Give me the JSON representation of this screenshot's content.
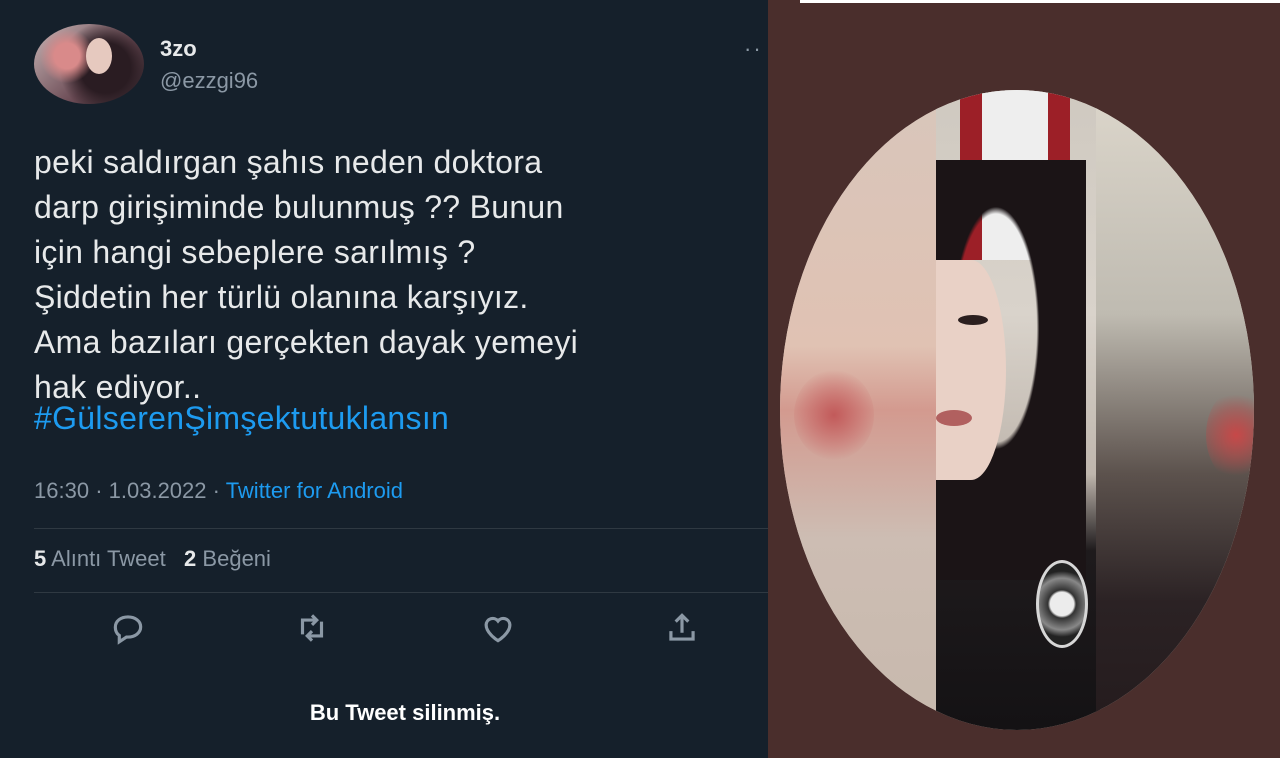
{
  "tweet": {
    "display_name": "3zo",
    "handle": "@ezzgi96",
    "more_glyph": "··",
    "text": "peki saldırgan şahıs neden doktora\ndarp girişiminde bulunmuş ?? Bunun\niçin hangi sebeplere sarılmış ?\nŞiddetin her türlü olanına karşıyız.\nAma bazıları gerçekten dayak yemeyi\nhak ediyor..",
    "hashtag": "#GülserenŞimşektutuklansın",
    "time": "16:30",
    "date": "1.03.2022",
    "separator": "·",
    "source": "Twitter for Android",
    "quote_count": "5",
    "quote_label": "Alıntı Tweet",
    "like_count": "2",
    "like_label": "Beğeni",
    "deleted_notice": "Bu Tweet silinmiş."
  },
  "icons": {
    "reply": "reply-icon",
    "retweet": "retweet-icon",
    "like": "heart-icon",
    "share": "share-icon"
  },
  "colors": {
    "tweet_bg": "#15202b",
    "link": "#1d9bf0",
    "muted": "#8b98a5",
    "photo_bg": "#4a2e2c"
  }
}
